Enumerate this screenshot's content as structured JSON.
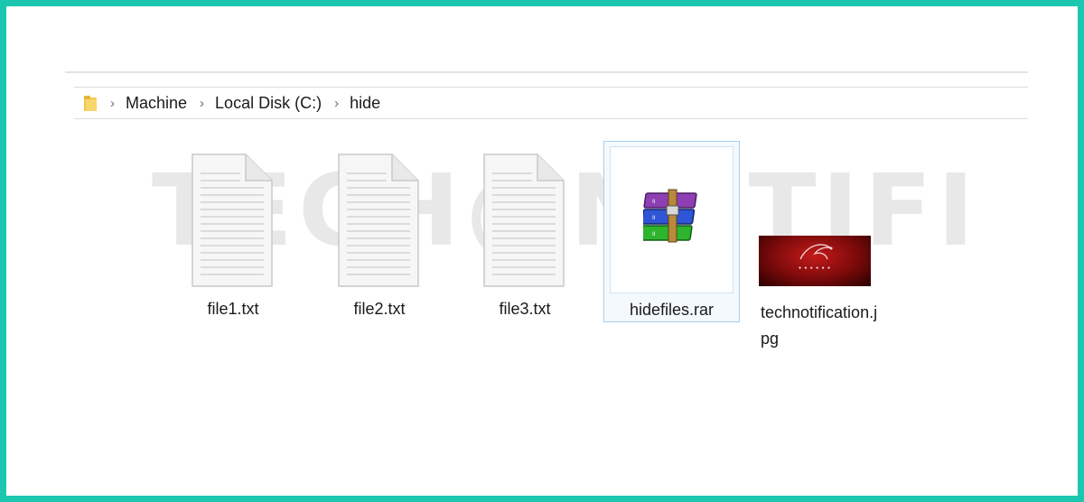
{
  "breadcrumb": {
    "items": [
      "Machine",
      "Local Disk (C:)",
      "hide"
    ],
    "separator": "›"
  },
  "watermark": {
    "text": "TECH@NOTIFICATION"
  },
  "files": [
    {
      "name": "file1.txt",
      "icon": "text-document-icon"
    },
    {
      "name": "file2.txt",
      "icon": "text-document-icon"
    },
    {
      "name": "file3.txt",
      "icon": "text-document-icon"
    },
    {
      "name": "hidefiles.rar",
      "icon": "winrar-archive-icon",
      "selected": true
    },
    {
      "name": "technotification.jpg",
      "name_line1": "technotification.j",
      "name_line2": "pg",
      "icon": "image-thumbnail"
    }
  ],
  "colors": {
    "frame_border": "#1cc7b0",
    "selection_border": "#a9cdea",
    "folder_icon": "#f3c74f"
  }
}
